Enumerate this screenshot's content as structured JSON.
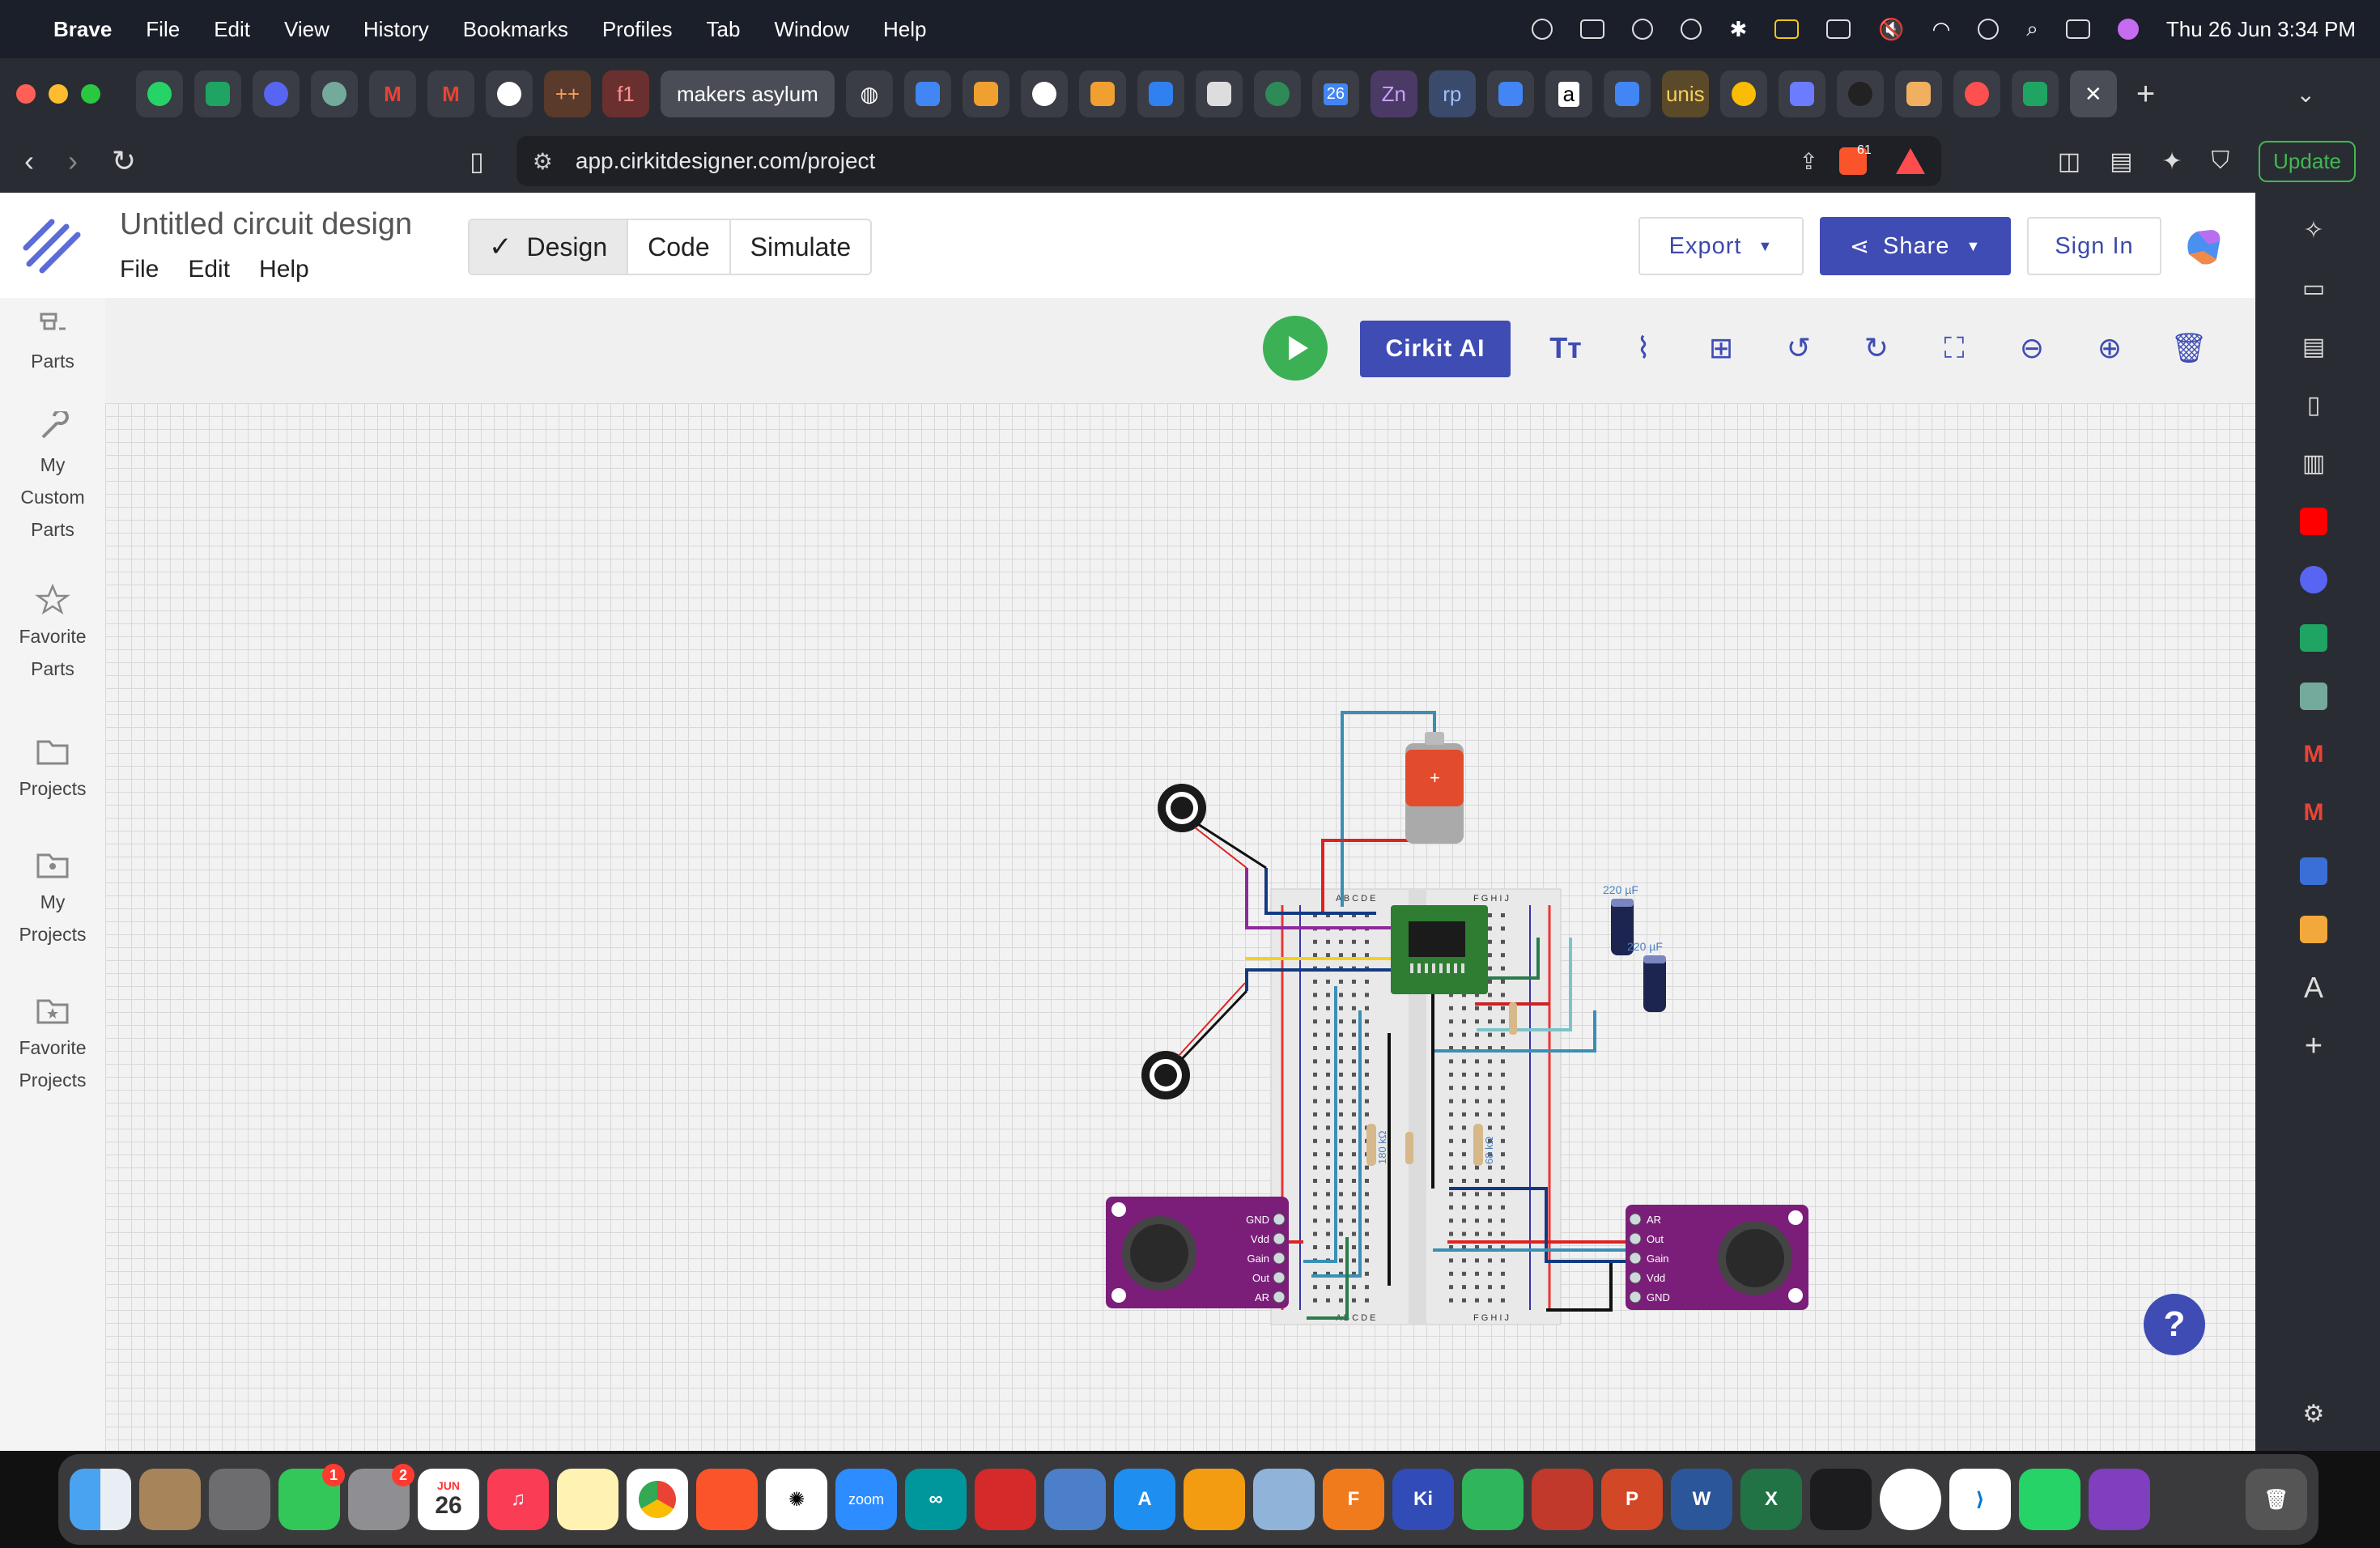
{
  "menubar": {
    "app_name": "Brave",
    "items": [
      "File",
      "Edit",
      "View",
      "History",
      "Bookmarks",
      "Profiles",
      "Tab",
      "Window",
      "Help"
    ],
    "clock": "Thu 26 Jun  3:34 PM"
  },
  "browser": {
    "tabs": {
      "plus_plus": "++",
      "f1": "f1",
      "active_label": "makers asylum",
      "zn": "Zn",
      "rp": "rp",
      "unis": "unis",
      "amazon": "a",
      "calendar": "26"
    },
    "address": "app.cirkitdesigner.com/project",
    "brave_badge": "61",
    "update_label": "Update"
  },
  "header": {
    "title": "Untitled circuit design",
    "menu": [
      "File",
      "Edit",
      "Help"
    ],
    "modes": {
      "design": "Design",
      "code": "Code",
      "simulate": "Simulate"
    },
    "export": "Export",
    "share": "Share",
    "signin": "Sign In"
  },
  "sidebar": {
    "parts": "Parts",
    "custom_1": "My",
    "custom_2": "Custom",
    "custom_3": "Parts",
    "fav_1": "Favorite",
    "fav_2": "Parts",
    "projects": "Projects",
    "myproj_1": "My",
    "myproj_2": "Projects",
    "favproj_1": "Favorite",
    "favproj_2": "Projects"
  },
  "toolbar": {
    "cirkit_ai": "Cirkit AI"
  },
  "circuit": {
    "cap1_label": "220 µF",
    "cap2_label": "220 µF",
    "res1_label": "180 kΩ",
    "res2_label": "68 kΩ",
    "bb_cols_left": "A B C D E",
    "bb_cols_right": "F G H I J",
    "mic_left_pins": [
      "GND",
      "Vdd",
      "Gain",
      "Out",
      "AR"
    ],
    "mic_right_pins": [
      "AR",
      "Out",
      "Gain",
      "Vdd",
      "GND"
    ]
  },
  "help": "?",
  "dock": {
    "messages_badge": "1",
    "settings_badge": "2",
    "cal_month": "JUN",
    "cal_day": "26",
    "zoom": "zoom",
    "kicad": "Ki"
  },
  "colors": {
    "accent": "#3f4cb4",
    "play": "#3cb054",
    "board_green": "#2e7d32",
    "mic_purple": "#7b1e7a"
  }
}
